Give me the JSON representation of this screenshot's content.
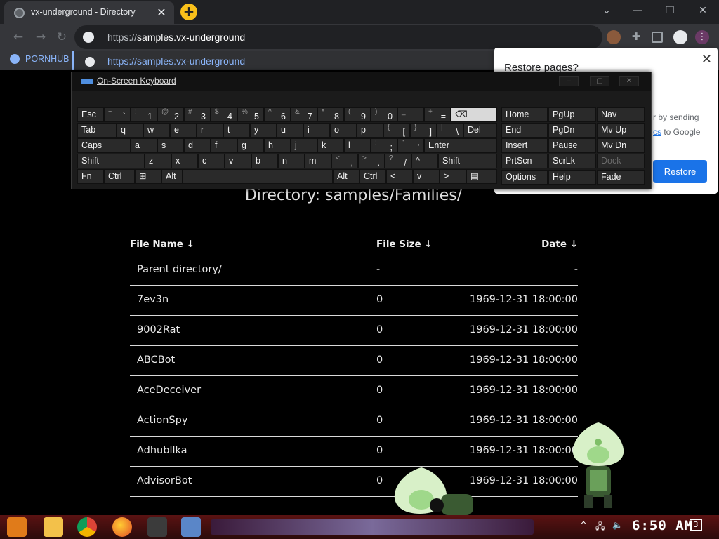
{
  "browser": {
    "tab_title": "vx-underground - Directory",
    "url_prefix": "https://",
    "url_host": "samples.vx-underground",
    "suggestion_url": "https://samples.vx-underground",
    "bookmark": "PORNHUB"
  },
  "restore_popup": {
    "heading": "Restore pages?",
    "line1": "r by sending",
    "line2_link": "cs",
    "line2_rest": "to Google",
    "button": "Restore"
  },
  "keyboard": {
    "title": "On-Screen Keyboard",
    "rows": [
      [
        {
          "p": "Esc"
        },
        {
          "s": "~",
          "p": "`"
        },
        {
          "s": "!",
          "p": "1"
        },
        {
          "s": "@",
          "p": "2"
        },
        {
          "s": "#",
          "p": "3"
        },
        {
          "s": "$",
          "p": "4"
        },
        {
          "s": "%",
          "p": "5"
        },
        {
          "s": "^",
          "p": "6"
        },
        {
          "s": "&",
          "p": "7"
        },
        {
          "s": "*",
          "p": "8"
        },
        {
          "s": "(",
          "p": "9"
        },
        {
          "s": ")",
          "p": "0"
        },
        {
          "s": "_",
          "p": "-"
        },
        {
          "s": "+",
          "p": "="
        },
        {
          "p": "⌫"
        }
      ],
      [
        {
          "p": "Tab"
        },
        {
          "p": "q"
        },
        {
          "p": "w"
        },
        {
          "p": "e"
        },
        {
          "p": "r"
        },
        {
          "p": "t"
        },
        {
          "p": "y"
        },
        {
          "p": "u"
        },
        {
          "p": "i"
        },
        {
          "p": "o"
        },
        {
          "p": "p"
        },
        {
          "s": "{",
          "p": "["
        },
        {
          "s": "}",
          "p": "]"
        },
        {
          "s": "|",
          "p": "\\"
        },
        {
          "p": "Del"
        }
      ],
      [
        {
          "p": "Caps"
        },
        {
          "p": "a"
        },
        {
          "p": "s"
        },
        {
          "p": "d"
        },
        {
          "p": "f"
        },
        {
          "p": "g"
        },
        {
          "p": "h"
        },
        {
          "p": "j"
        },
        {
          "p": "k"
        },
        {
          "p": "l"
        },
        {
          "s": ":",
          "p": ";"
        },
        {
          "s": "\"",
          "p": "'"
        },
        {
          "p": "Enter"
        }
      ],
      [
        {
          "p": "Shift"
        },
        {
          "p": "z"
        },
        {
          "p": "x"
        },
        {
          "p": "c"
        },
        {
          "p": "v"
        },
        {
          "p": "b"
        },
        {
          "p": "n"
        },
        {
          "p": "m"
        },
        {
          "s": "<",
          "p": ","
        },
        {
          "s": ">",
          "p": "."
        },
        {
          "s": "?",
          "p": "/"
        },
        {
          "p": "^"
        },
        {
          "p": "Shift"
        }
      ],
      [
        {
          "p": "Fn"
        },
        {
          "p": "Ctrl"
        },
        {
          "p": "⊞"
        },
        {
          "p": "Alt"
        },
        {
          "p": ""
        },
        {
          "p": "Alt"
        },
        {
          "p": "Ctrl"
        },
        {
          "p": "<"
        },
        {
          "p": "v"
        },
        {
          "p": ">"
        },
        {
          "p": "▤"
        }
      ]
    ],
    "nav_keys": [
      [
        "Home",
        "PgUp",
        "Nav"
      ],
      [
        "End",
        "PgDn",
        "Mv Up"
      ],
      [
        "Insert",
        "Pause",
        "Mv Dn"
      ],
      [
        "PrtScn",
        "ScrLk",
        "Dock"
      ],
      [
        "Options",
        "Help",
        "Fade"
      ]
    ]
  },
  "page": {
    "directory_title": "Directory: samples/Families/",
    "columns": {
      "name": "File Name  ↓",
      "size": "File Size  ↓",
      "date": "Date  ↓"
    },
    "rows": [
      {
        "name": "Parent directory/",
        "size": "-",
        "date": "-"
      },
      {
        "name": "7ev3n",
        "size": "0",
        "date": "1969-12-31 18:00:00"
      },
      {
        "name": "9002Rat",
        "size": "0",
        "date": "1969-12-31 18:00:00"
      },
      {
        "name": "ABCBot",
        "size": "0",
        "date": "1969-12-31 18:00:00"
      },
      {
        "name": "AceDeceiver",
        "size": "0",
        "date": "1969-12-31 18:00:00"
      },
      {
        "name": "ActionSpy",
        "size": "0",
        "date": "1969-12-31 18:00:00"
      },
      {
        "name": "Adhubllka",
        "size": "0",
        "date": "1969-12-31 18:00:00"
      },
      {
        "name": "AdvisorBot",
        "size": "0",
        "date": "1969-12-31 18:00:00"
      }
    ]
  },
  "taskbar": {
    "clock": "6:50 AM",
    "notification_count": "3"
  }
}
